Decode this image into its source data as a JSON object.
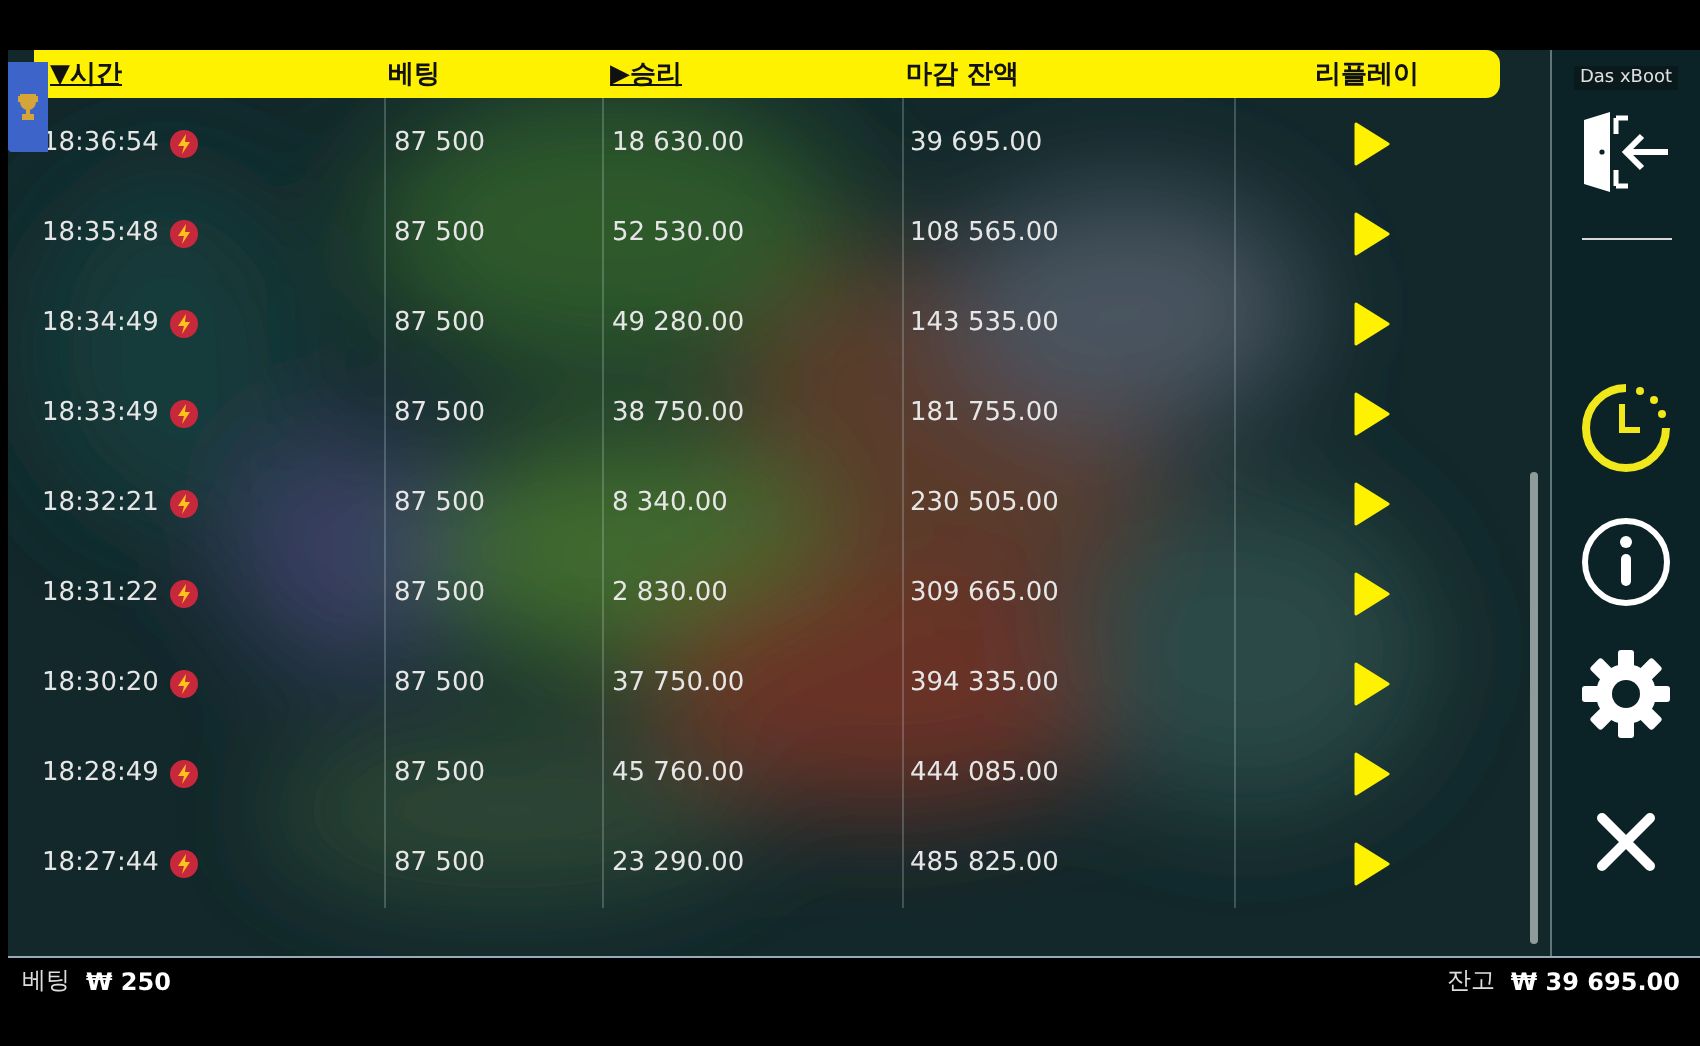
{
  "table": {
    "columns": [
      {
        "label": "시간",
        "sort_mark": "▼",
        "sorted": true
      },
      {
        "label": "베팅",
        "sorted": false
      },
      {
        "label": "승리",
        "sort_mark": "▶",
        "sorted": true
      },
      {
        "label": "마감 잔액",
        "sorted": false
      },
      {
        "label": "리플레이",
        "sorted": false
      }
    ],
    "rows": [
      {
        "time": "18:36:54",
        "bet": "87 500",
        "win": "18 630.00",
        "balance": "39 695.00"
      },
      {
        "time": "18:35:48",
        "bet": "87 500",
        "win": "52 530.00",
        "balance": "108 565.00"
      },
      {
        "time": "18:34:49",
        "bet": "87 500",
        "win": "49 280.00",
        "balance": "143 535.00"
      },
      {
        "time": "18:33:49",
        "bet": "87 500",
        "win": "38 750.00",
        "balance": "181 755.00"
      },
      {
        "time": "18:32:21",
        "bet": "87 500",
        "win": "8 340.00",
        "balance": "230 505.00"
      },
      {
        "time": "18:31:22",
        "bet": "87 500",
        "win": "2 830.00",
        "balance": "309 665.00"
      },
      {
        "time": "18:30:20",
        "bet": "87 500",
        "win": "37 750.00",
        "balance": "394 335.00"
      },
      {
        "time": "18:28:49",
        "bet": "87 500",
        "win": "45 760.00",
        "balance": "444 085.00"
      },
      {
        "time": "18:27:44",
        "bet": "87 500",
        "win": "23 290.00",
        "balance": "485 825.00"
      }
    ]
  },
  "sidebar": {
    "game_name": "Das xBoot",
    "buttons": [
      {
        "kind": "exit",
        "selected": false
      },
      {
        "kind": "history",
        "selected": true
      },
      {
        "kind": "info",
        "selected": false
      },
      {
        "kind": "settings",
        "selected": false
      },
      {
        "kind": "close",
        "selected": false
      }
    ]
  },
  "footer": {
    "bet_label": "베팅",
    "bet_value": "₩ 250",
    "balance_label": "잔고",
    "balance_value": "₩ 39 695.00"
  }
}
